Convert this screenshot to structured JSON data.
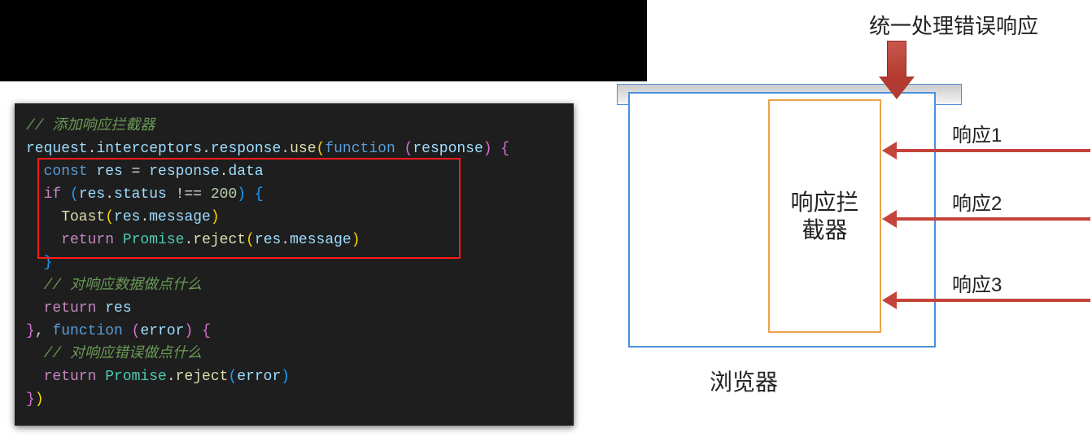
{
  "code": {
    "comment_add": "// 添加响应拦截器",
    "l1a": "request",
    "l1b": ".",
    "l1c": "interceptors",
    "l1d": ".",
    "l1e": "response",
    "l1f": ".",
    "l1g": "use",
    "l1h": "(",
    "l1i": "function ",
    "l1j": "(",
    "l1k": "response",
    "l1l": ") ",
    "l1m": "{",
    "l2a": "  const ",
    "l2b": "res",
    "l2c": " = ",
    "l2d": "response",
    "l2e": ".",
    "l2f": "data",
    "l3a": "  if ",
    "l3b": "(",
    "l3c": "res",
    "l3d": ".",
    "l3e": "status",
    "l3f": " !== ",
    "l3g": "200",
    "l3h": ") ",
    "l3i": "{",
    "l4a": "    Toast",
    "l4b": "(",
    "l4c": "res",
    "l4d": ".",
    "l4e": "message",
    "l4f": ")",
    "l5a": "    return ",
    "l5b": "Promise",
    "l5c": ".",
    "l5d": "reject",
    "l5e": "(",
    "l5f": "res",
    "l5g": ".",
    "l5h": "message",
    "l5i": ")",
    "l6a": "  }",
    "comment_do": "  // 对响应数据做点什么",
    "l8a": "  return ",
    "l8b": "res",
    "l9a": "}",
    "l9b": ", ",
    "l9c": "function ",
    "l9d": "(",
    "l9e": "error",
    "l9f": ") ",
    "l9g": "{",
    "comment_err": "  // 对响应错误做点什么",
    "l11a": "  return ",
    "l11b": "Promise",
    "l11c": ".",
    "l11d": "reject",
    "l11e": "(",
    "l11f": "error",
    "l11g": ")",
    "l12a": "}",
    "l12b": ")"
  },
  "diagram": {
    "title": "统一处理错误响应",
    "interceptor": "响应拦截器",
    "browser": "浏览器",
    "resp1": "响应1",
    "resp2": "响应2",
    "resp3": "响应3"
  }
}
